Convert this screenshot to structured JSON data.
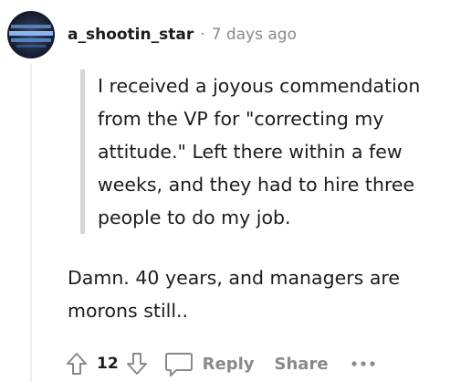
{
  "comment": {
    "username": "a_shootin_star",
    "separator": "·",
    "timestamp": "7 days ago",
    "quote_text": "I received a joyous commendation from the VP for \"correcting my attitude.\" Left there within a few weeks, and they had to hire three people to do my job.",
    "body_text": "Damn. 40 years, and managers are morons still.."
  },
  "actions": {
    "score": "12",
    "reply_label": "Reply",
    "share_label": "Share"
  },
  "icons": {
    "avatar": "avatar-image",
    "upvote": "upvote-arrow-icon",
    "downvote": "downvote-arrow-icon",
    "reply": "speech-bubble-icon",
    "more": "ellipsis-icon"
  },
  "colors": {
    "text": "#1c1c1c",
    "meta": "#878a8c",
    "quote_bar": "#d6d6d6",
    "thread_line": "#edeff1"
  }
}
